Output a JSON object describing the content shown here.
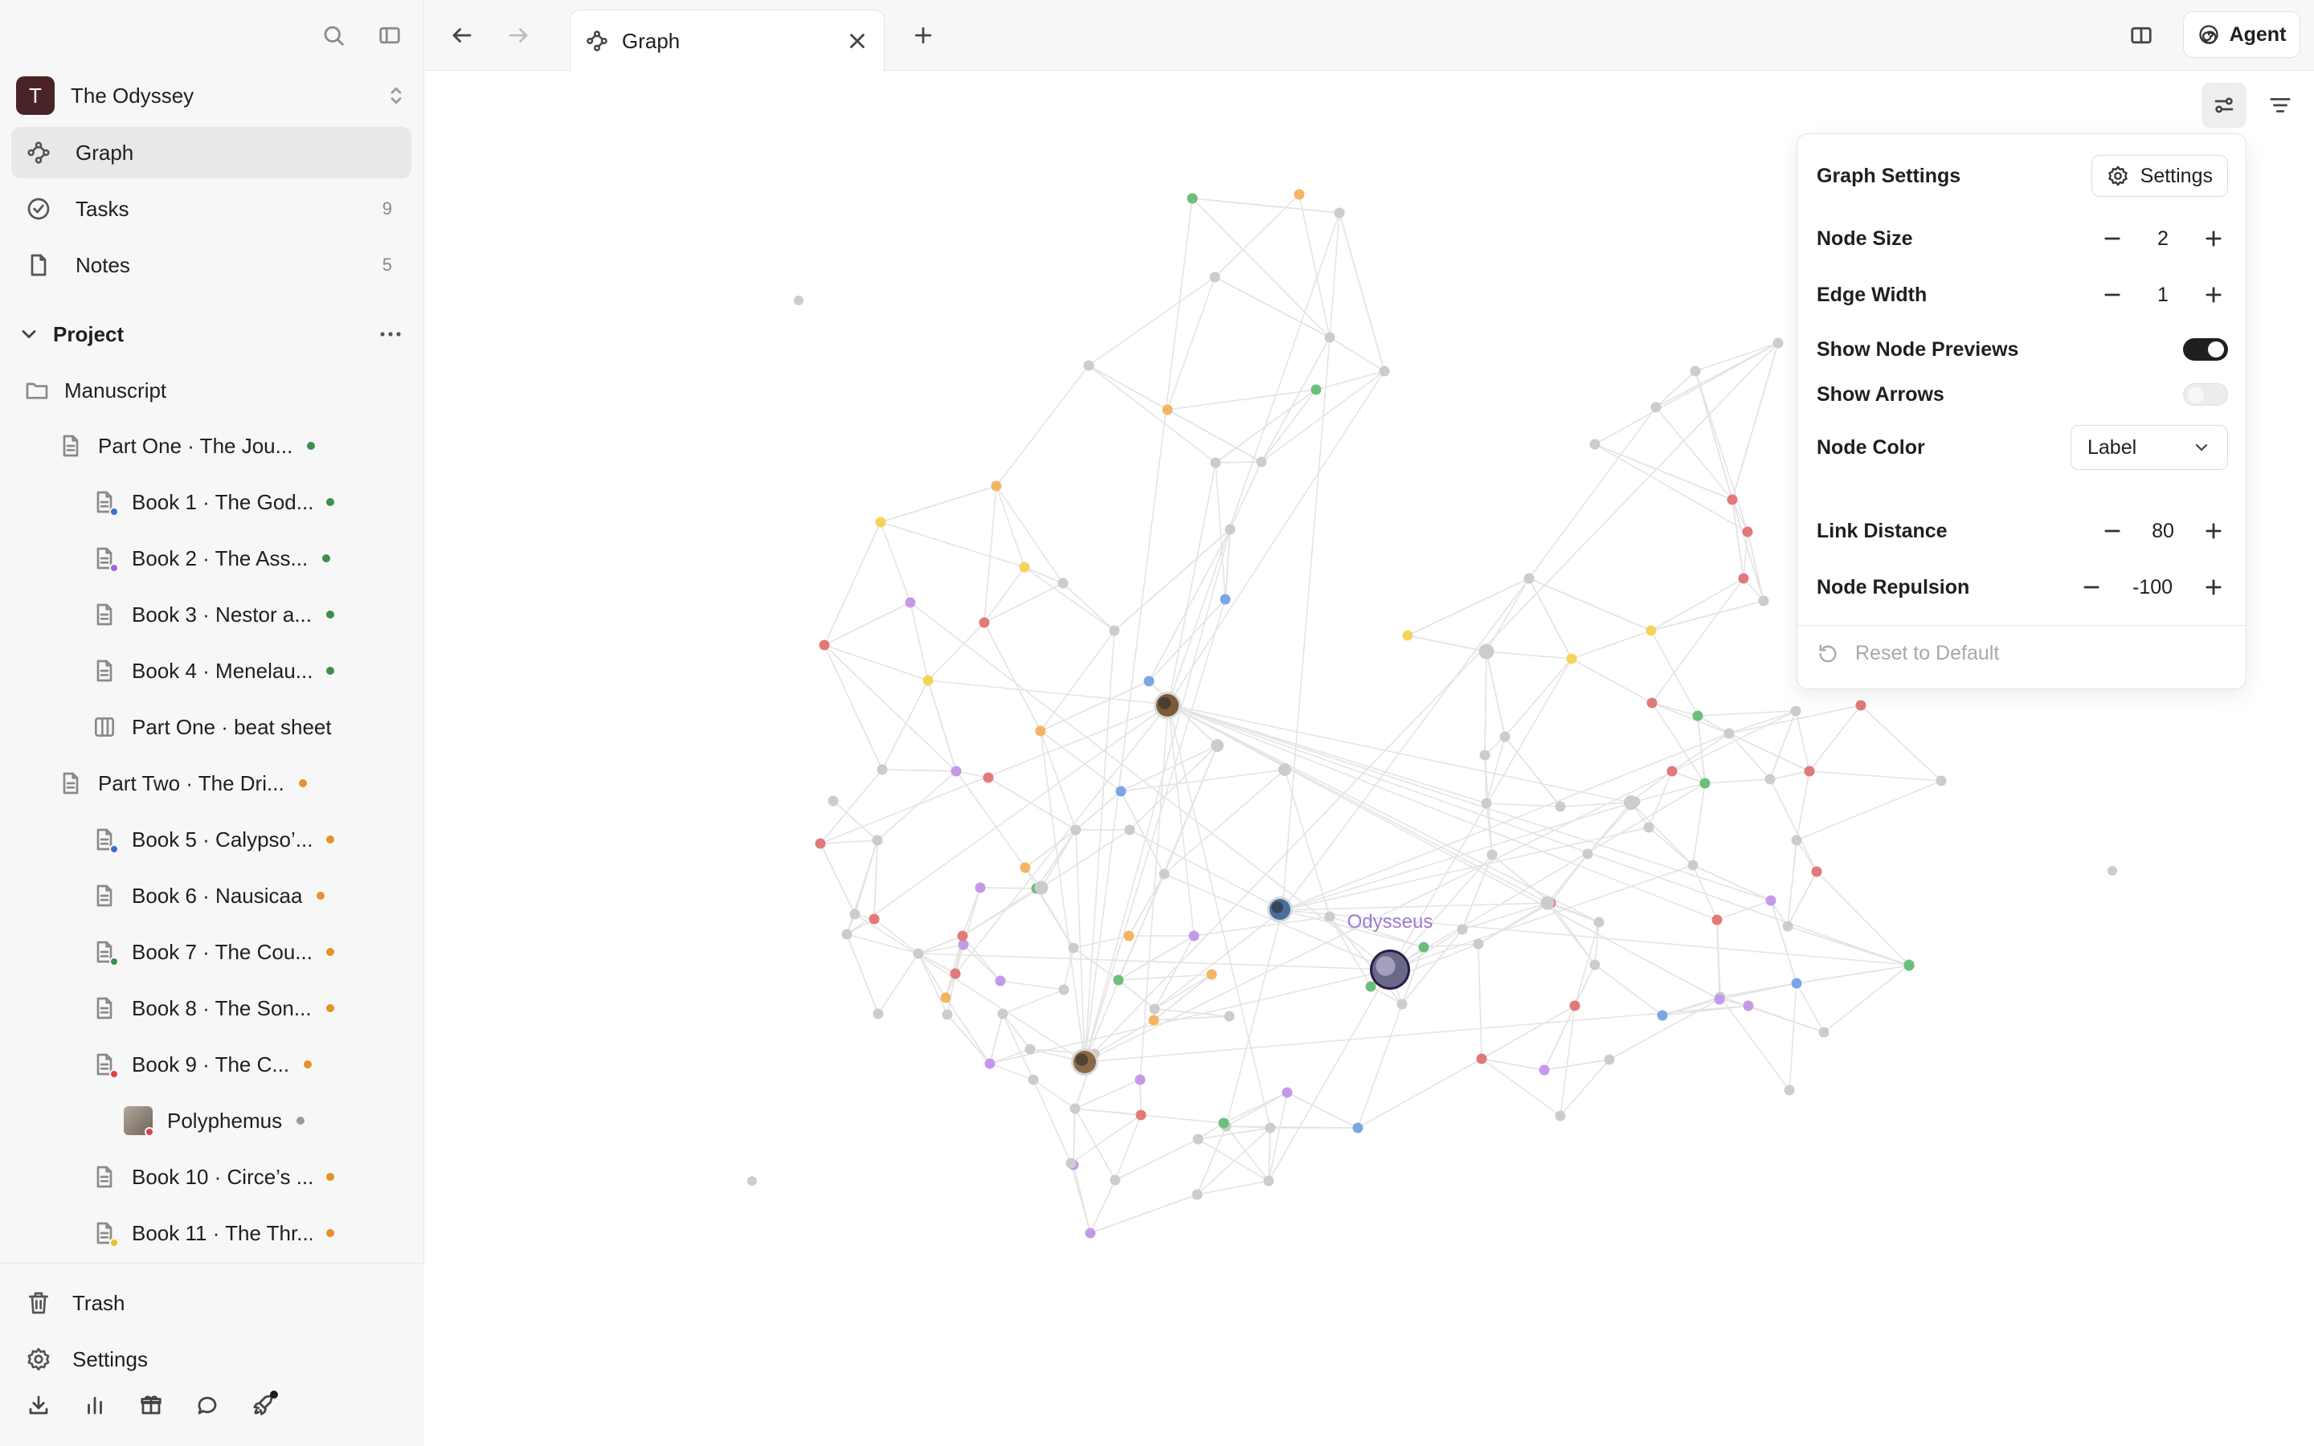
{
  "workspace": {
    "initial": "T",
    "name": "The Odyssey"
  },
  "nav": [
    {
      "label": "Graph",
      "count": ""
    },
    {
      "label": "Tasks",
      "count": "9"
    },
    {
      "label": "Notes",
      "count": "5"
    }
  ],
  "project": {
    "label": "Project"
  },
  "tree": [
    {
      "label": "Manuscript",
      "icon": "folder-icon",
      "badge": "",
      "dot": ""
    },
    {
      "label": "Part One · The Jou...",
      "icon": "document-icon",
      "badge": "",
      "dot": "#3e8e4e"
    },
    {
      "label": "Book 1 · The God...",
      "icon": "document-icon",
      "badge": "#3b6fd6",
      "dot": "#3e8e4e"
    },
    {
      "label": "Book 2 · The Ass...",
      "icon": "document-icon",
      "badge": "#9b6ad8",
      "dot": "#3e8e4e"
    },
    {
      "label": "Book 3 · Nestor a...",
      "icon": "document-icon",
      "badge": "",
      "dot": "#3e8e4e"
    },
    {
      "label": "Book 4 · Menelau...",
      "icon": "document-icon",
      "badge": "",
      "dot": "#3e8e4e"
    },
    {
      "label": "Part One · beat sheet",
      "icon": "board-icon",
      "badge": "",
      "dot": ""
    },
    {
      "label": "Part Two · The Dri...",
      "icon": "document-icon",
      "badge": "",
      "dot": "#e8902a"
    },
    {
      "label": "Book 5 · Calypso’...",
      "icon": "document-icon",
      "badge": "#3b6fd6",
      "dot": "#e8902a"
    },
    {
      "label": "Book 6 · Nausicaa",
      "icon": "document-icon",
      "badge": "",
      "dot": "#e8902a"
    },
    {
      "label": "Book 7 · The Cou...",
      "icon": "document-icon",
      "badge": "#3e8e4e",
      "dot": "#e8902a"
    },
    {
      "label": "Book 8 · The Son...",
      "icon": "document-icon",
      "badge": "",
      "dot": "#e8902a"
    },
    {
      "label": "Book 9 · The C...",
      "icon": "document-icon",
      "badge": "#d64545",
      "dot": "#e8902a"
    },
    {
      "label": "Polyphemus",
      "icon": "image-thumbnail",
      "badge": "#d64545",
      "dot": "#9a9a9a"
    },
    {
      "label": "Book 10 · Circe’s ...",
      "icon": "document-icon",
      "badge": "",
      "dot": "#e8902a"
    },
    {
      "label": "Book 11 · The Thr...",
      "icon": "document-icon",
      "badge": "#e8c020",
      "dot": "#e8902a"
    }
  ],
  "footer": {
    "trash": "Trash",
    "settings": "Settings"
  },
  "tab": {
    "label": "Graph"
  },
  "agent": {
    "label": "Agent"
  },
  "graph": {
    "focus_label": "Odysseus"
  },
  "panel": {
    "title": "Graph Settings",
    "settings_button": "Settings",
    "node_size": {
      "label": "Node Size",
      "value": "2"
    },
    "edge_width": {
      "label": "Edge Width",
      "value": "1"
    },
    "show_node_previews": {
      "label": "Show Node Previews",
      "on": true
    },
    "show_arrows": {
      "label": "Show Arrows",
      "on": false
    },
    "node_color": {
      "label": "Node Color",
      "value": "Label"
    },
    "link_distance": {
      "label": "Link Distance",
      "value": "80"
    },
    "node_repulsion": {
      "label": "Node Repulsion",
      "value": "-100"
    },
    "reset": "Reset to Default"
  },
  "colors": {
    "green": "#6cbf7a",
    "orange": "#f3b562",
    "yellow": "#f5d35a",
    "red": "#e07a7a",
    "purple": "#c49ae8",
    "blue": "#7aa6e6",
    "gray": "#cccccc",
    "edge": "#e4e4e4",
    "label_purple": "#a07bd0"
  }
}
